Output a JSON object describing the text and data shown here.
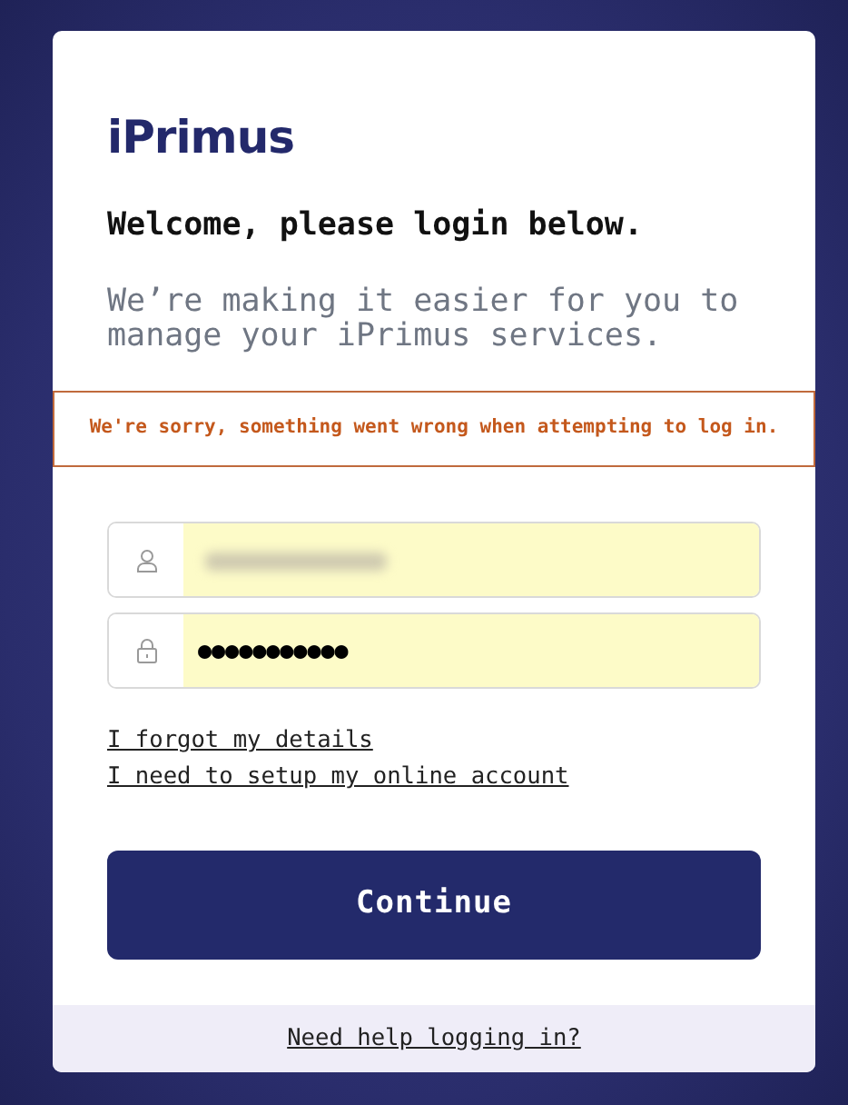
{
  "logo": "iPrimus",
  "heading": "Welcome, please login below.",
  "subtitle": "We’re making it easier for you to manage your iPrimus services.",
  "error": "We're sorry, something went wrong when attempting to log in.",
  "fields": [
    {
      "kind": "username",
      "autofilled": true
    },
    {
      "kind": "password",
      "value": "●●●●●●●●●●●",
      "autofilled": true
    }
  ],
  "links": [
    "I forgot my details",
    "I need to setup my online account"
  ],
  "submit": "Continue",
  "footer_link": "Need help logging in?"
}
